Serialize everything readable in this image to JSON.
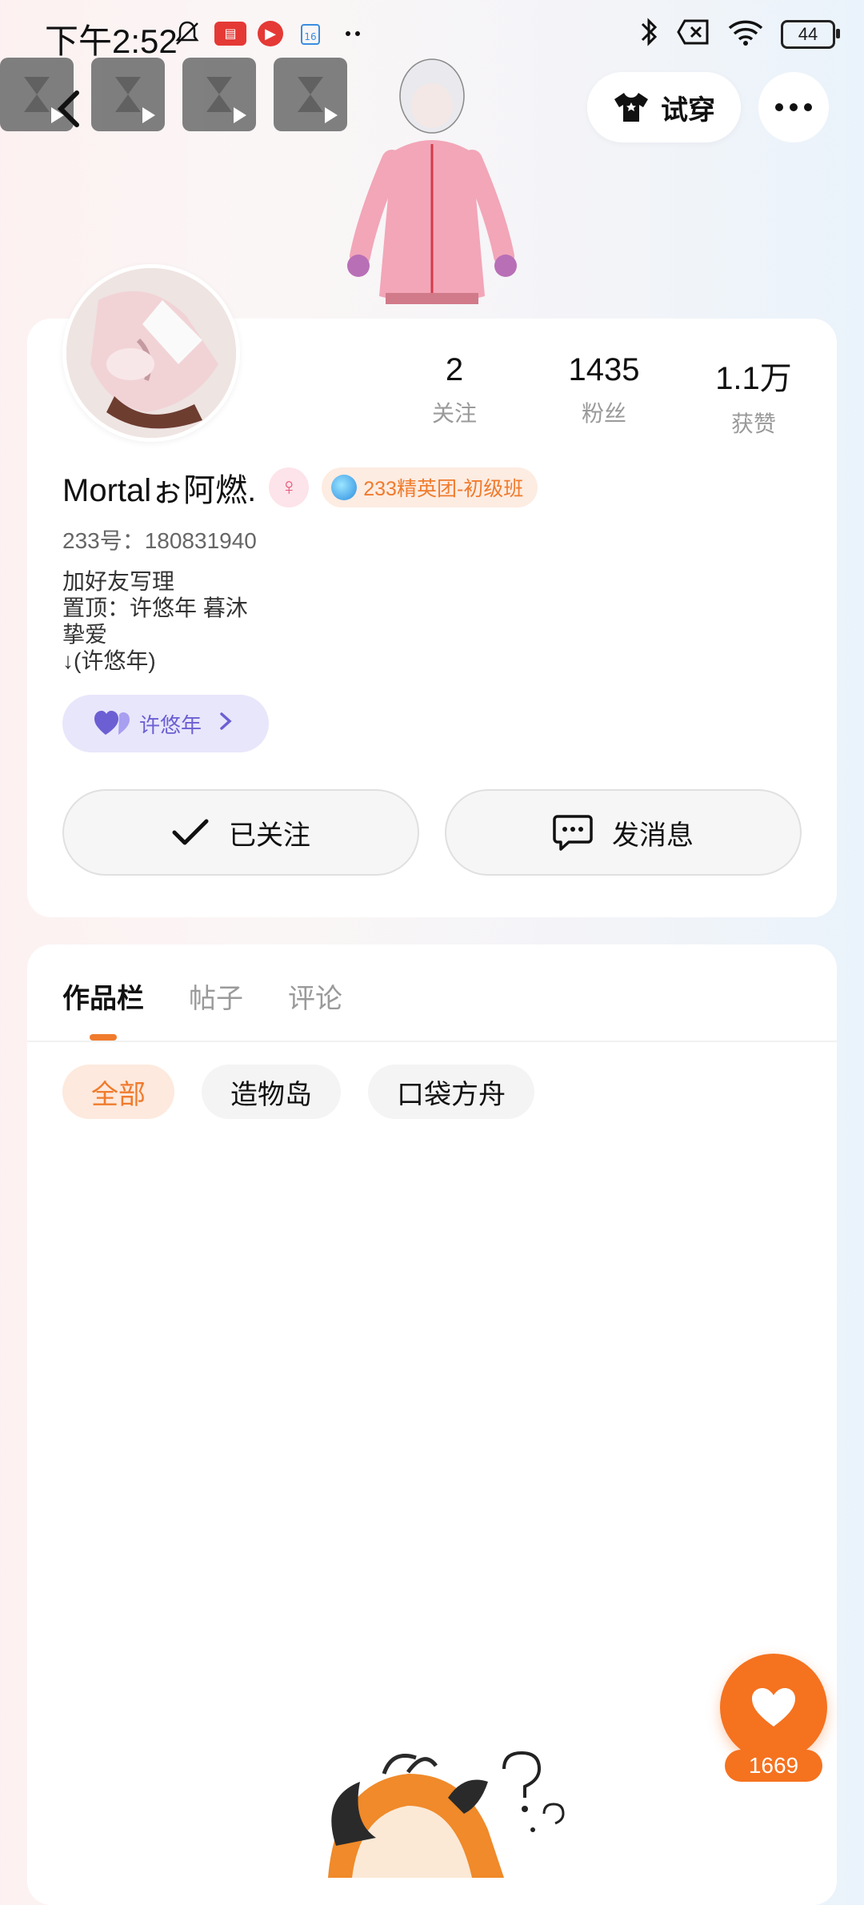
{
  "status_bar": {
    "time": "下午2:52",
    "battery": "44"
  },
  "top_actions": {
    "tryon_label": "试穿"
  },
  "profile": {
    "name": "Mortalぉ阿燃.",
    "gender_symbol": "♀",
    "level_badge": "233精英团-初级班",
    "uid": "233号：180831940",
    "bio_lines": [
      "加好友写理",
      "置顶：许悠年 暮沐",
      "挚爱",
      "↓(许悠年)"
    ],
    "cp_name": "许悠年"
  },
  "stats": [
    {
      "value": "2",
      "label": "关注"
    },
    {
      "value": "1435",
      "label": "粉丝"
    },
    {
      "value": "1.1万",
      "label": "获赞"
    }
  ],
  "actions": {
    "follow_label": "已关注",
    "message_label": "发消息"
  },
  "tabs": [
    "作品栏",
    "帖子",
    "评论"
  ],
  "filters": [
    "全部",
    "造物岛",
    "口袋方舟"
  ],
  "like": {
    "count": "1669"
  },
  "colors": {
    "accent": "#f07b2d",
    "like_fab": "#f5721f",
    "cp_purple": "#6b5fd3"
  }
}
